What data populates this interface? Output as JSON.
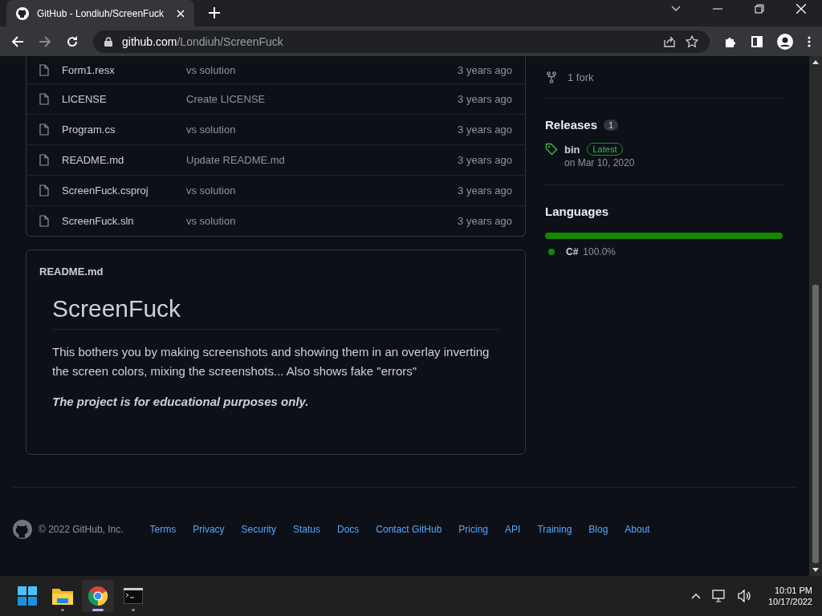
{
  "browser": {
    "tab_title": "GitHub - Londiuh/ScreenFuck",
    "url_host": "github.com",
    "url_path": "/Londiuh/ScreenFuck"
  },
  "files": [
    {
      "name": "Form1.resx",
      "message": "vs solution",
      "age": "3 years ago"
    },
    {
      "name": "LICENSE",
      "message": "Create LICENSE",
      "age": "3 years ago"
    },
    {
      "name": "Program.cs",
      "message": "vs solution",
      "age": "3 years ago"
    },
    {
      "name": "README.md",
      "message": "Update README.md",
      "age": "3 years ago"
    },
    {
      "name": "ScreenFuck.csproj",
      "message": "vs solution",
      "age": "3 years ago"
    },
    {
      "name": "ScreenFuck.sln",
      "message": "vs solution",
      "age": "3 years ago"
    }
  ],
  "readme": {
    "filename": "README.md",
    "heading": "ScreenFuck",
    "paragraph": "This bothers you by making screenshots and showing them in an overlay inverting the screen colors, mixing the screenshots... Also shows fake \"errors\"",
    "note": "The project is for educational purposes only."
  },
  "sidebar": {
    "forks": "1 fork",
    "releases_title": "Releases",
    "releases_count": "1",
    "release": {
      "tag": "bin",
      "badge": "Latest",
      "date": "on Mar 10, 2020"
    },
    "languages_title": "Languages",
    "languages": [
      {
        "name": "C#",
        "percent": "100.0%",
        "level": 1.0,
        "color": "#178600"
      }
    ]
  },
  "footer": {
    "copyright": "© 2022 GitHub, Inc.",
    "links": [
      "Terms",
      "Privacy",
      "Security",
      "Status",
      "Docs",
      "Contact GitHub",
      "Pricing",
      "API",
      "Training",
      "Blog",
      "About"
    ]
  },
  "taskbar": {
    "apps": [
      {
        "kind": "files",
        "selected": false
      },
      {
        "kind": "chrome",
        "selected": true
      },
      {
        "kind": "terminal",
        "selected": false
      }
    ],
    "time": "10:01 PM",
    "date": "10/17/2022"
  }
}
